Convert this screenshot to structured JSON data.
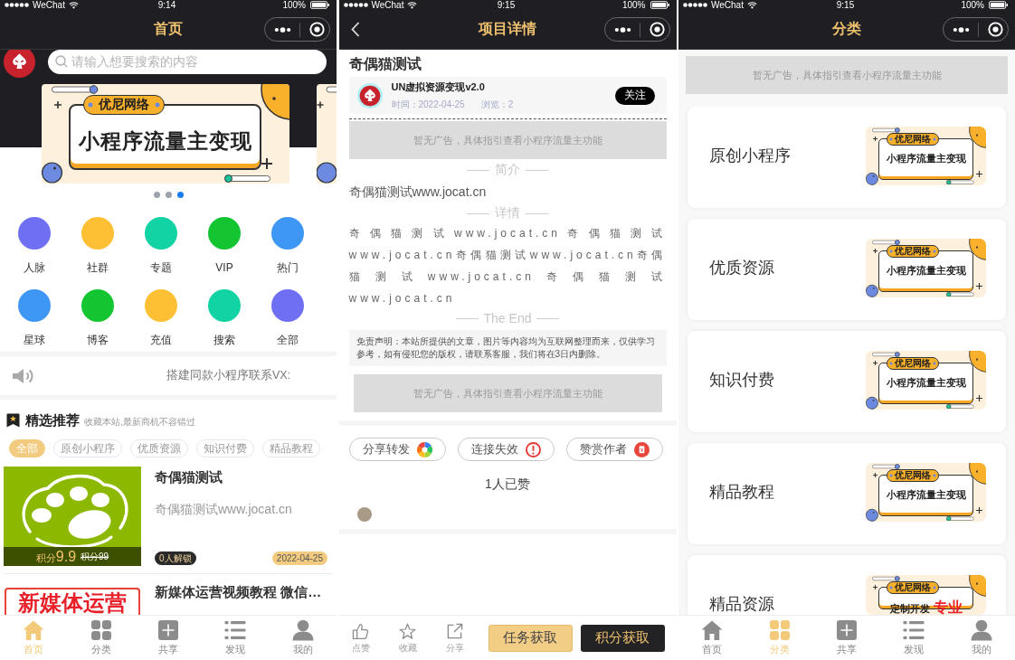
{
  "home_screen": {
    "status_bar": {
      "carrier": "WeChat",
      "time": "9:14",
      "battery": "100%"
    },
    "nav_bar": {
      "title": "首页"
    },
    "search": {
      "placeholder": "请输入想要搜索的内容"
    },
    "banner": {
      "tag": "优尼网络",
      "headline": "小程序流量主变现"
    },
    "banner_dots": [
      {
        "selected": false
      },
      {
        "selected": false
      },
      {
        "selected": true
      }
    ],
    "shortcuts": [
      {
        "label": "人脉",
        "color": "#6e6ff2"
      },
      {
        "label": "社群",
        "color": "#fdbf33"
      },
      {
        "label": "专题",
        "color": "#12d3a4"
      },
      {
        "label": "VIP",
        "color": "#14c532"
      },
      {
        "label": "热门",
        "color": "#3f97f5"
      },
      {
        "label": "星球",
        "color": "#3f97f5"
      },
      {
        "label": "博客",
        "color": "#14c532"
      },
      {
        "label": "充值",
        "color": "#fdbf33"
      },
      {
        "label": "搜索",
        "color": "#12d3a4"
      },
      {
        "label": "全部",
        "color": "#6e6ff2"
      }
    ],
    "notice": "搭建同款小程序联系VX:",
    "section": {
      "title": "精选推荐",
      "subtitle": "收藏本站,最新商机不容错过"
    },
    "filters": [
      {
        "label": "全部",
        "selected": true
      },
      {
        "label": "原创小程序",
        "selected": false
      },
      {
        "label": "优质资源",
        "selected": false
      },
      {
        "label": "知识付费",
        "selected": false
      },
      {
        "label": "精品教程",
        "selected": false
      }
    ],
    "items": [
      {
        "kind": "paw",
        "title": "奇偶猫测试",
        "description": "奇偶猫测试www.jocat.cn",
        "price_unit": "积分",
        "price": "9.9",
        "original_price": "积分99",
        "unlocks": "0人解锁",
        "date": "2022-04-25"
      },
      {
        "kind": "poster",
        "thumbnail_text": "新媒体运营",
        "title": "新媒体运营视频教程 微信…"
      }
    ],
    "tab_bar": [
      {
        "kind": "home",
        "label": "首页",
        "selected": true
      },
      {
        "kind": "grid",
        "label": "分类",
        "selected": false
      },
      {
        "kind": "plus",
        "label": "共享",
        "selected": false
      },
      {
        "kind": "list",
        "label": "发现",
        "selected": false
      },
      {
        "kind": "person",
        "label": "我的",
        "selected": false
      }
    ]
  },
  "detail_screen": {
    "status_bar": {
      "carrier": "WeChat",
      "time": "9:15",
      "battery": "100%"
    },
    "nav_bar": {
      "title": "项目详情",
      "back": true
    },
    "title": "奇偶猫测试",
    "author": {
      "name": "UN虚拟资源变现v2.0",
      "time": "时间：2022-04-25",
      "views": "浏览：2",
      "follow": "关注"
    },
    "ad_top": "暂无广告，具体指引查看小程序流量主功能",
    "intro_heading": "简介",
    "intro": "奇偶猫测试www.jocat.cn",
    "details_heading": "详情",
    "details": "奇偶猫测试www.jocat.cn奇偶猫测试www.jocat.cn奇偶猫测试www.jocat.cn奇偶猫测试www.jocat.cn奇偶猫测试www.jocat.cn",
    "end_heading": "The End",
    "disclaimer": "免责声明：本站所提供的文章，图片等内容均为互联网整理而来，仅供学习参考，如有侵犯您的版权，请联系客服，我们将在3日内删除。",
    "ad_bottom": "暂无广告，具体指引查看小程序流量主功能",
    "actions": [
      {
        "kind": "share",
        "label": "分享转发"
      },
      {
        "kind": "broken",
        "label": "连接失效"
      },
      {
        "kind": "reward",
        "label": "赞赏作者"
      }
    ],
    "likes": "1人已赞",
    "tools": [
      {
        "kind": "like",
        "label": "点赞"
      },
      {
        "kind": "favorite",
        "label": "收藏"
      },
      {
        "kind": "share",
        "label": "分享"
      }
    ],
    "buttons": [
      {
        "kind": "task",
        "label": "任务获取"
      },
      {
        "kind": "points",
        "label": "积分获取"
      }
    ]
  },
  "category_screen": {
    "status_bar": {
      "carrier": "WeChat",
      "time": "9:15",
      "battery": "100%"
    },
    "nav_bar": {
      "title": "分类"
    },
    "ad": "暂无广告，具体指引查看小程序流量主功能",
    "categories": [
      {
        "label": "原创小程序",
        "thumbnail": {
          "tag": "优尼网络",
          "headline": "小程序流量主变现"
        }
      },
      {
        "label": "优质资源",
        "thumbnail": {
          "tag": "优尼网络",
          "headline": "小程序流量主变现"
        }
      },
      {
        "label": "知识付费",
        "thumbnail": {
          "tag": "优尼网络",
          "headline": "小程序流量主变现"
        }
      },
      {
        "label": "精品教程",
        "thumbnail": {
          "tag": "优尼网络",
          "headline": "小程序流量主变现"
        }
      },
      {
        "label": "精品资源",
        "thumbnail": {
          "tag": "优尼网络",
          "headline": "定制开发",
          "highlight": "专业"
        }
      }
    ],
    "tab_bar": [
      {
        "kind": "home",
        "label": "首页",
        "selected": false
      },
      {
        "kind": "grid",
        "label": "分类",
        "selected": true
      },
      {
        "kind": "plus",
        "label": "共享",
        "selected": false
      },
      {
        "kind": "list",
        "label": "发现",
        "selected": false
      },
      {
        "kind": "person",
        "label": "我的",
        "selected": false
      }
    ]
  }
}
